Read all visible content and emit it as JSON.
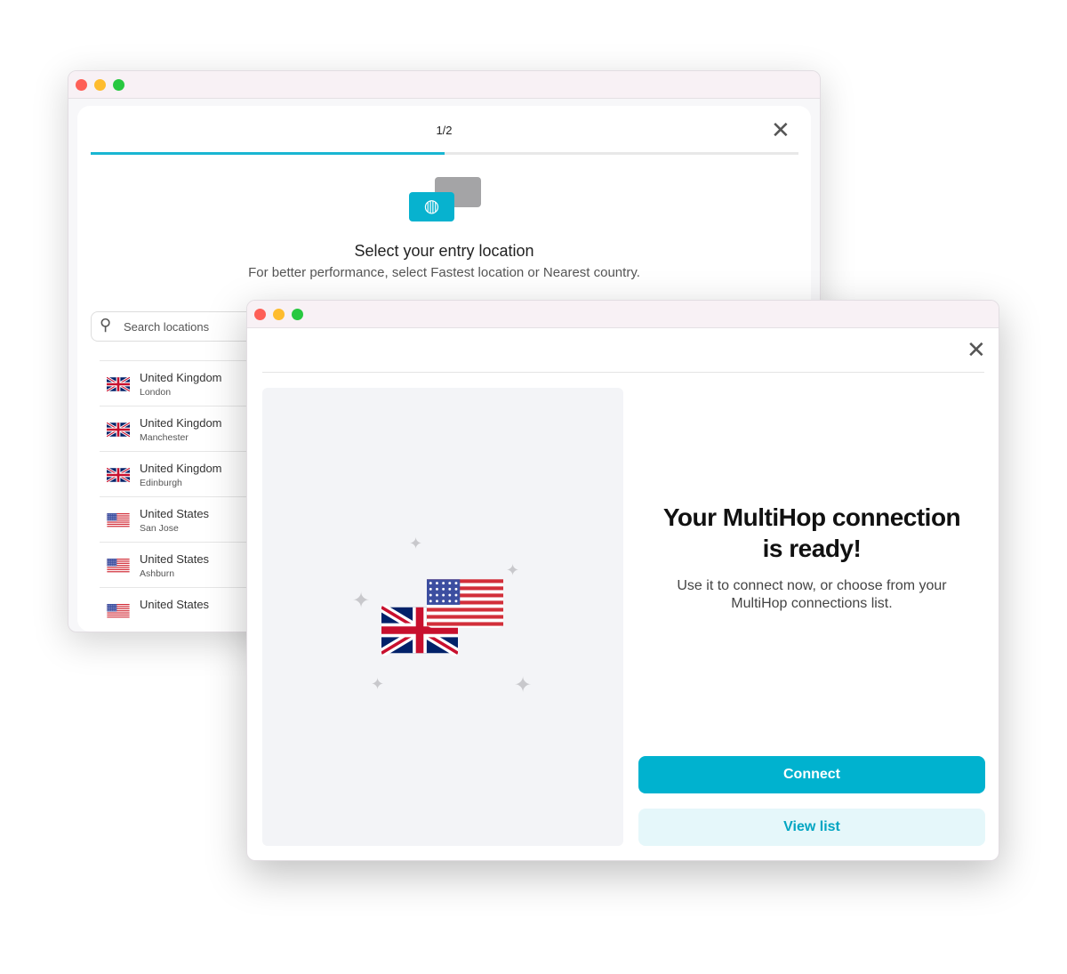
{
  "entry_window": {
    "step": "1/2",
    "progress": 0.5,
    "title": "Select your entry location",
    "subtitle": "For better performance, select Fastest location or Nearest country.",
    "search_placeholder": "Search locations",
    "locations": [
      {
        "country": "United Kingdom",
        "city": "London",
        "flag": "uk"
      },
      {
        "country": "United Kingdom",
        "city": "Manchester",
        "flag": "uk"
      },
      {
        "country": "United Kingdom",
        "city": "Edinburgh",
        "flag": "uk"
      },
      {
        "country": "United States",
        "city": "San Jose",
        "flag": "us"
      },
      {
        "country": "United States",
        "city": "Ashburn",
        "flag": "us"
      },
      {
        "country": "United States",
        "city": "",
        "flag": "us"
      }
    ]
  },
  "ready_window": {
    "headline_line1": "Your MultiHop connection",
    "headline_line2": "is ready!",
    "body_line1": "Use it to connect now, or choose from your",
    "body_line2": "MultiHop connections list.",
    "connect_label": "Connect",
    "view_list_label": "View list"
  },
  "colors": {
    "accent": "#00b2cf",
    "accent_light": "#e5f7fa",
    "close": "#fe5f57",
    "minimize": "#febc2e",
    "zoom": "#28c840"
  }
}
